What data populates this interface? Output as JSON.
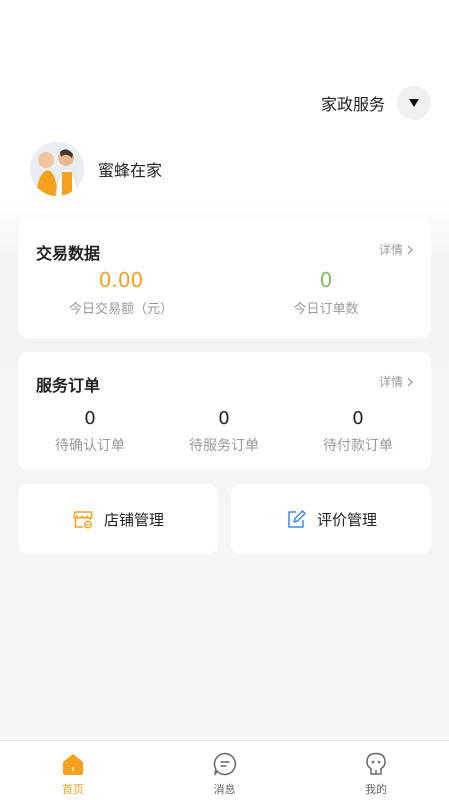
{
  "header": {
    "service_label": "家政服务"
  },
  "store": {
    "name": "蜜蜂在家"
  },
  "trade": {
    "title": "交易数据",
    "detail_label": "详情",
    "amount_value": "0.00",
    "amount_label": "今日交易额（元）",
    "orders_value": "0",
    "orders_label": "今日订单数",
    "colors": {
      "amount": "#f5a11c",
      "orders": "#7cc35a"
    }
  },
  "service_orders": {
    "title": "服务订单",
    "detail_label": "详情",
    "stats": [
      {
        "value": "0",
        "label": "待确认订单"
      },
      {
        "value": "0",
        "label": "待服务订单"
      },
      {
        "value": "0",
        "label": "待付款订单"
      }
    ]
  },
  "actions": [
    {
      "label": "店铺管理",
      "icon": "store-settings-icon"
    },
    {
      "label": "评价管理",
      "icon": "edit-review-icon"
    }
  ],
  "tabbar": [
    {
      "label": "首页",
      "icon": "home-icon",
      "active": true
    },
    {
      "label": "消息",
      "icon": "message-icon",
      "active": false
    },
    {
      "label": "我的",
      "icon": "profile-icon",
      "active": false
    }
  ],
  "accent_color": "#f5a11c"
}
